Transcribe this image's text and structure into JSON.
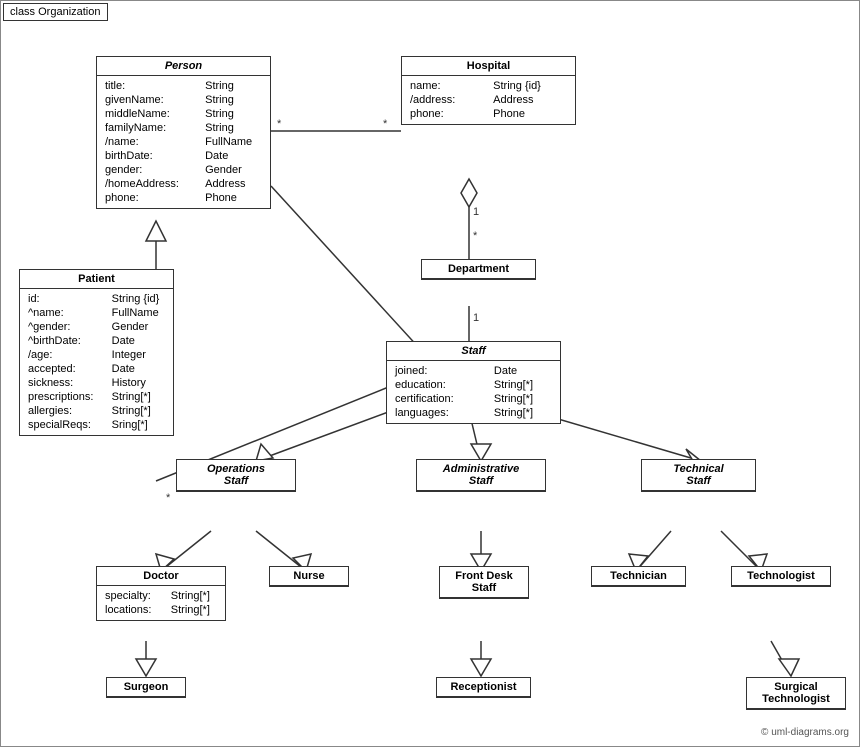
{
  "diagram": {
    "frame_label": "class Organization",
    "copyright": "© uml-diagrams.org",
    "classes": {
      "person": {
        "title": "Person",
        "italic": true,
        "fields": [
          [
            "title:",
            "String"
          ],
          [
            "givenName:",
            "String"
          ],
          [
            "middleName:",
            "String"
          ],
          [
            "familyName:",
            "String"
          ],
          [
            "/name:",
            "FullName"
          ],
          [
            "birthDate:",
            "Date"
          ],
          [
            "gender:",
            "Gender"
          ],
          [
            "/homeAddress:",
            "Address"
          ],
          [
            "phone:",
            "Phone"
          ]
        ]
      },
      "hospital": {
        "title": "Hospital",
        "italic": false,
        "fields": [
          [
            "name:",
            "String {id}"
          ],
          [
            "/address:",
            "Address"
          ],
          [
            "phone:",
            "Phone"
          ]
        ]
      },
      "department": {
        "title": "Department",
        "italic": false,
        "fields": []
      },
      "patient": {
        "title": "Patient",
        "italic": false,
        "fields": [
          [
            "id:",
            "String {id}"
          ],
          [
            "^name:",
            "FullName"
          ],
          [
            "^gender:",
            "Gender"
          ],
          [
            "^birthDate:",
            "Date"
          ],
          [
            "/age:",
            "Integer"
          ],
          [
            "accepted:",
            "Date"
          ],
          [
            "sickness:",
            "History"
          ],
          [
            "prescriptions:",
            "String[*]"
          ],
          [
            "allergies:",
            "String[*]"
          ],
          [
            "specialReqs:",
            "Sring[*]"
          ]
        ]
      },
      "staff": {
        "title": "Staff",
        "italic": true,
        "fields": [
          [
            "joined:",
            "Date"
          ],
          [
            "education:",
            "String[*]"
          ],
          [
            "certification:",
            "String[*]"
          ],
          [
            "languages:",
            "String[*]"
          ]
        ]
      },
      "operations_staff": {
        "title": "Operations Staff",
        "italic": true,
        "fields": []
      },
      "administrative_staff": {
        "title": "Administrative Staff",
        "italic": true,
        "fields": []
      },
      "technical_staff": {
        "title": "Technical Staff",
        "italic": true,
        "fields": []
      },
      "doctor": {
        "title": "Doctor",
        "italic": false,
        "fields": [
          [
            "specialty:",
            "String[*]"
          ],
          [
            "locations:",
            "String[*]"
          ]
        ]
      },
      "nurse": {
        "title": "Nurse",
        "italic": false,
        "fields": []
      },
      "front_desk_staff": {
        "title": "Front Desk Staff",
        "italic": false,
        "fields": []
      },
      "technician": {
        "title": "Technician",
        "italic": false,
        "fields": []
      },
      "technologist": {
        "title": "Technologist",
        "italic": false,
        "fields": []
      },
      "surgeon": {
        "title": "Surgeon",
        "italic": false,
        "fields": []
      },
      "receptionist": {
        "title": "Receptionist",
        "italic": false,
        "fields": []
      },
      "surgical_technologist": {
        "title": "Surgical Technologist",
        "italic": false,
        "fields": []
      }
    }
  }
}
